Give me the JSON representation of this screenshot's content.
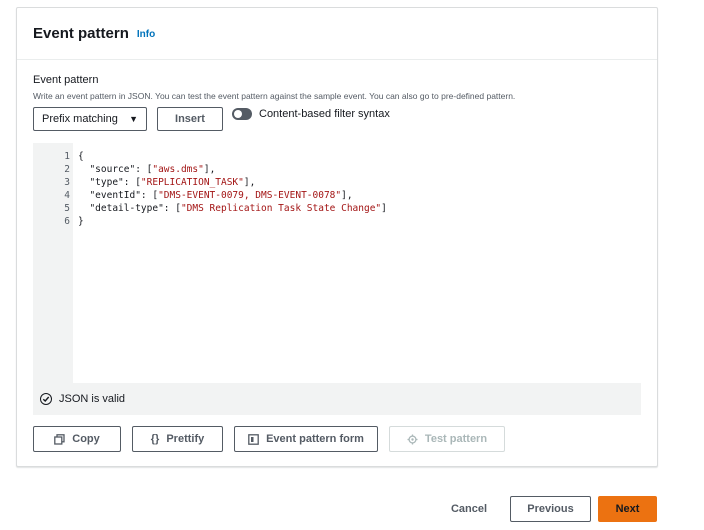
{
  "panel": {
    "title": "Event pattern",
    "info_link": "Info"
  },
  "field": {
    "label": "Event pattern",
    "description": "Write an event pattern in JSON. You can test the event pattern against the sample event. You can also go to pre-defined pattern."
  },
  "controls": {
    "select_value": "Prefix matching",
    "insert_label": "Insert",
    "toggle_label": "Content-based filter syntax"
  },
  "editor": {
    "lines": [
      {
        "n": "1",
        "pre": "{",
        "str": "",
        "post": ""
      },
      {
        "n": "2",
        "pre": "  \"source\": [",
        "str": "\"aws.dms\"",
        "post": "],"
      },
      {
        "n": "3",
        "pre": "  \"type\": [",
        "str": "\"REPLICATION_TASK\"",
        "post": "],"
      },
      {
        "n": "4",
        "pre": "  \"eventId\": [",
        "str": "\"DMS-EVENT-0079, DMS-EVENT-0078\"",
        "post": "],"
      },
      {
        "n": "5",
        "pre": "  \"detail-type\": [",
        "str": "\"DMS Replication Task State Change\"",
        "post": "]"
      },
      {
        "n": "6",
        "pre": "}",
        "str": "",
        "post": ""
      }
    ],
    "status_text": "JSON is valid"
  },
  "actions": {
    "copy": "Copy",
    "prettify": "Prettify",
    "form": "Event pattern form",
    "test": "Test pattern"
  },
  "footer": {
    "cancel": "Cancel",
    "previous": "Previous",
    "next": "Next"
  },
  "colors": {
    "accent": "#ec7211",
    "link": "#0073bb",
    "string": "#a31515"
  }
}
